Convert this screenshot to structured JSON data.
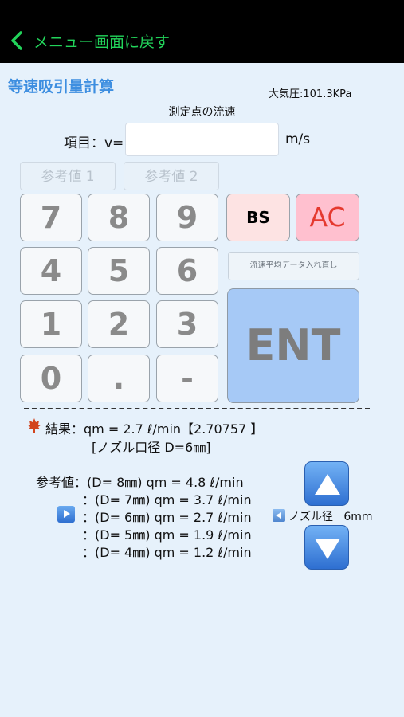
{
  "nav": {
    "back_label": "メニュー画面に戻す"
  },
  "header": {
    "title": "等速吸引量計算",
    "pressure": "大気圧:101.3KPa",
    "subtitle": "測定点の流速"
  },
  "input": {
    "label": "項目：v=",
    "value": "",
    "unit": "m/s"
  },
  "ref_buttons": [
    "参考値 1",
    "参考値 2"
  ],
  "keypad": {
    "keys": [
      "7",
      "8",
      "9",
      "4",
      "5",
      "6",
      "1",
      "2",
      "3",
      "0",
      ".",
      "-"
    ],
    "bs_label": "BS",
    "ac_label": "AC",
    "reload_label": "流速平均データ入れ直し",
    "ent_label": "ENT"
  },
  "result": {
    "line1": "結果：qm = 2.7 ℓ/min【2.70757 】",
    "line2": "[ノズル口径 D=6㎜]"
  },
  "reference": {
    "label": "参考値：",
    "lines": [
      "(D= 8㎜) qm = 4.8 ℓ/min",
      "：(D= 7㎜) qm = 3.7 ℓ/min",
      "：(D= 6㎜) qm = 2.7 ℓ/min",
      "：(D= 5㎜) qm = 1.9 ℓ/min",
      "：(D= 4㎜) qm = 1.2 ℓ/min"
    ]
  },
  "nozzle": {
    "label": "ノズル径",
    "value": "6mm"
  },
  "colors": {
    "accent": "#3d8ee0",
    "back": "#22d35a",
    "background": "#e6f1fb"
  }
}
